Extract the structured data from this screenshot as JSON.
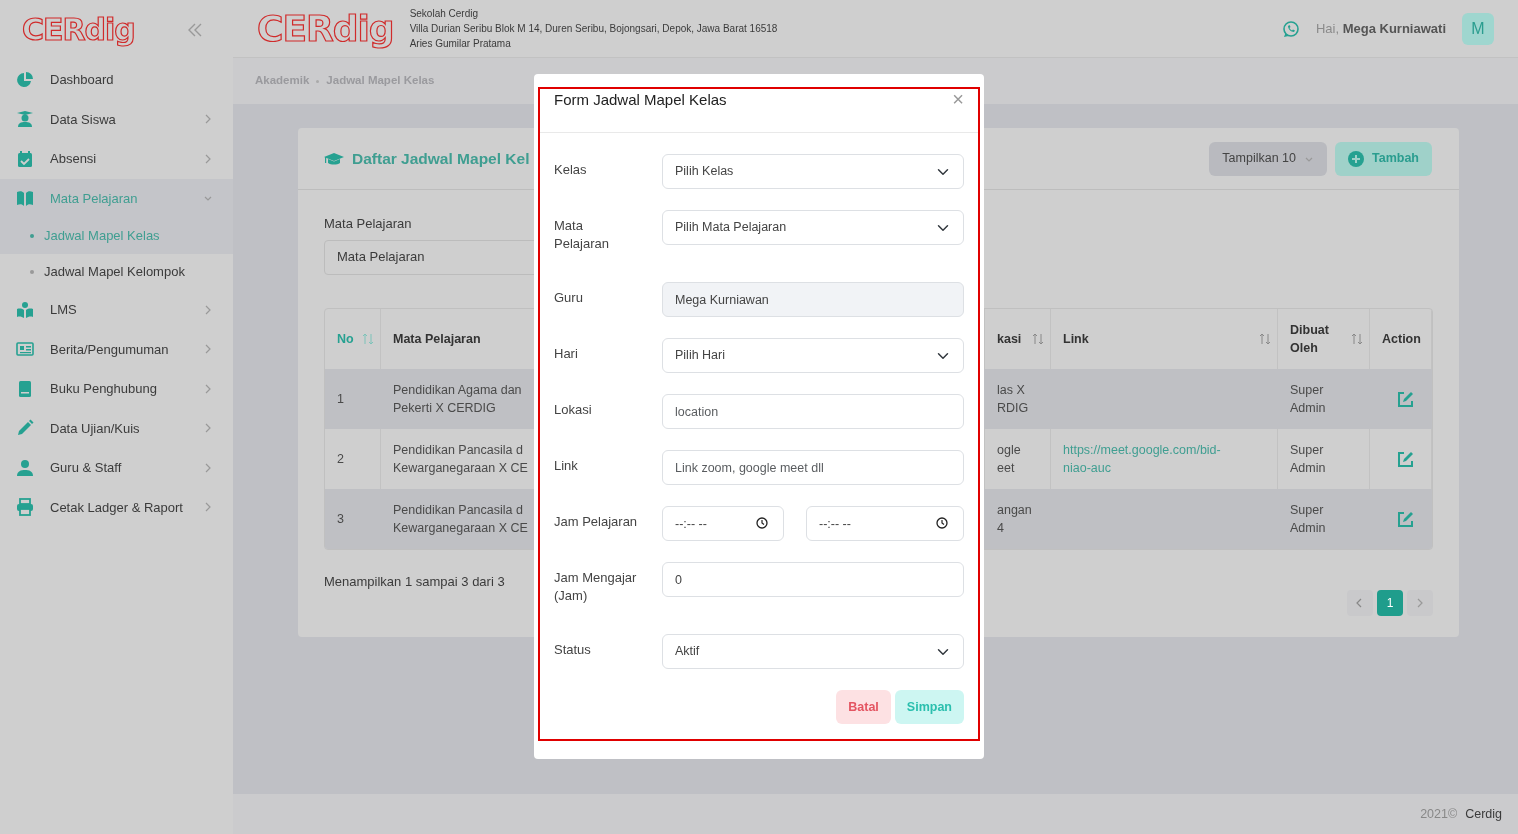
{
  "sidebar": {
    "logo_text": "CERdig",
    "items": [
      {
        "kind": "link",
        "label": "Dashboard",
        "selected": false
      },
      {
        "kind": "menu",
        "label": "Data Siswa",
        "selected": false,
        "expanded": false
      },
      {
        "kind": "menu",
        "label": "Absensi",
        "selected": false,
        "expanded": false
      },
      {
        "kind": "menu",
        "label": "Mata Pelajaran",
        "selected": true,
        "expanded": true,
        "children": [
          {
            "label": "Jadwal Mapel Kelas",
            "selected": true
          },
          {
            "label": "Jadwal Mapel Kelompok",
            "selected": false
          }
        ]
      },
      {
        "kind": "menu",
        "label": "LMS",
        "selected": false,
        "expanded": false
      },
      {
        "kind": "menu",
        "label": "Berita/Pengumuman",
        "selected": false,
        "expanded": false
      },
      {
        "kind": "menu",
        "label": "Buku Penghubung",
        "selected": false,
        "expanded": false
      },
      {
        "kind": "menu",
        "label": "Data Ujian/Kuis",
        "selected": false,
        "expanded": false
      },
      {
        "kind": "menu",
        "label": "Guru & Staff",
        "selected": false,
        "expanded": false
      },
      {
        "kind": "menu",
        "label": "Cetak Ladger & Raport",
        "selected": false,
        "expanded": false
      }
    ]
  },
  "header": {
    "logo_text": "CERdig",
    "school": "Sekolah Cerdig",
    "address": "Villa Durian Seribu Blok M 14, Duren Seribu, Bojongsari, Depok, Jawa Barat 16518",
    "principal": "Aries Gumilar Pratama",
    "greeting": "Hai, **Mega Kurniawati**",
    "avatar": "M"
  },
  "breadcrumb": [
    "Akademik",
    "Jadwal Mapel Kelas"
  ],
  "card": {
    "title": "Daftar Jadwal Mapel Kel",
    "page_size": "Tampilkan 10",
    "add_button": "Tambah",
    "filter_label": "Mata Pelajaran",
    "filter_value": "Mata Pelajaran",
    "columns": [
      {
        "label": "No",
        "sortable": true,
        "sorted": true
      },
      {
        "label": "Mata Pelajaran",
        "sortable": false,
        "sorted": false
      },
      {
        "label": "kasi",
        "sortable": true,
        "sorted": false
      },
      {
        "label": "Link",
        "sortable": true,
        "sorted": false
      },
      {
        "label": "Dibuat\nOleh",
        "sortable": true,
        "sorted": false
      },
      {
        "label": "Action",
        "sortable": false,
        "sorted": false
      }
    ],
    "rows": [
      {
        "no": "1",
        "subject": "Pendidikan Agama dan\nPekerti X CERDIG",
        "location": "las X\nRDIG",
        "created_by": "Super\nAdmin"
      },
      {
        "no": "2",
        "subject": "Pendidikan Pancasila d\nKewarganegaraan X CE",
        "location": "ogle\neet",
        "link": "https://meet.google.com/bid-\nniao-auc",
        "created_by": "Super\nAdmin"
      },
      {
        "no": "3",
        "subject": "Pendidikan Pancasila d\nKewarganegaraan X CE",
        "location": "angan\n4",
        "created_by": "Super\nAdmin"
      }
    ],
    "summary": "Menampilkan 1 sampai 3 dari 3",
    "pages": [
      {
        "label": "1",
        "selected": true
      }
    ]
  },
  "footer": {
    "year": "2021©",
    "brand": "Cerdig"
  },
  "modal": {
    "title": "Form Jadwal Mapel Kelas",
    "close": "×",
    "fields": [
      {
        "kind": "select",
        "label": "Kelas",
        "value": "Pilih Kelas"
      },
      {
        "kind": "select",
        "label": "Mata\nPelajaran",
        "value": "Pilih Mata Pelajaran"
      },
      {
        "kind": "text",
        "label": "Guru",
        "value": "Mega Kurniawan",
        "disabled": true
      },
      {
        "kind": "select",
        "label": "Hari",
        "value": "Pilih Hari"
      },
      {
        "kind": "text",
        "label": "Lokasi",
        "placeholder": "location",
        "disabled": false
      },
      {
        "kind": "text",
        "label": "Link",
        "placeholder": "Link zoom, google meet dll",
        "disabled": false
      },
      {
        "kind": "time_range",
        "label": "Jam Pelajaran",
        "values": [
          "--:-- --",
          "--:-- --"
        ]
      },
      {
        "kind": "text",
        "label": "Jam Mengajar\n(Jam)",
        "value": "0",
        "disabled": false
      },
      {
        "kind": "select",
        "label": "Status",
        "value": "Aktif"
      }
    ],
    "buttons": [
      {
        "kind": "cancel",
        "label": "Batal"
      },
      {
        "kind": "save",
        "label": "Simpan"
      }
    ]
  }
}
